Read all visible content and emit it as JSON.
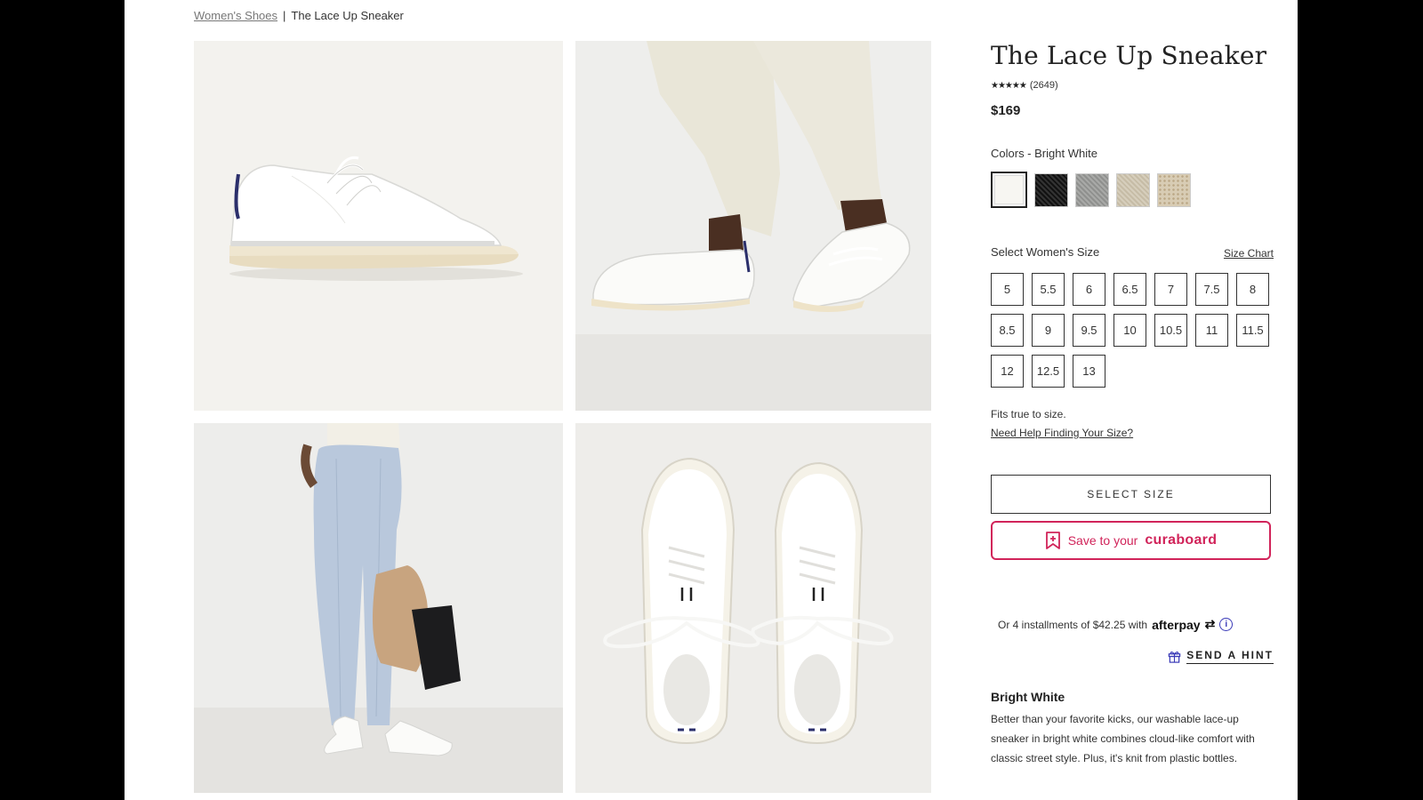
{
  "breadcrumb": {
    "parent": "Women's Shoes",
    "separator": "|",
    "current": "The Lace Up Sneaker"
  },
  "product": {
    "title": "The Lace Up Sneaker",
    "stars": "★★★★★",
    "rating": 4.5,
    "review_count": "(2649)",
    "price": "$169"
  },
  "colors": {
    "label": "Colors - Bright White",
    "swatches": [
      {
        "name": "Bright White",
        "color": "#f7f6f2",
        "selected": true
      },
      {
        "name": "Black",
        "color": "#1c1c1e",
        "selected": false
      },
      {
        "name": "Grey",
        "color": "#9b9c9a",
        "selected": false
      },
      {
        "name": "Sand",
        "color": "#cfc6b2",
        "selected": false
      },
      {
        "name": "Speckle",
        "color": "#d8ccb4",
        "selected": false
      }
    ]
  },
  "size": {
    "label": "Select Women's Size",
    "chart_link": "Size Chart",
    "options": [
      "5",
      "5.5",
      "6",
      "6.5",
      "7",
      "7.5",
      "8",
      "8.5",
      "9",
      "9.5",
      "10",
      "10.5",
      "11",
      "11.5",
      "12",
      "12.5",
      "13"
    ],
    "fits": "Fits true to size.",
    "help_link": "Need Help Finding Your Size?"
  },
  "actions": {
    "select_size": "SELECT SIZE",
    "save_prefix": "Save to your",
    "save_brand": "curaboard"
  },
  "afterpay": {
    "text": "Or 4 installments of $42.25 with",
    "brand": "afterpay",
    "brand_symbol": "⇄",
    "info": "i"
  },
  "hint": {
    "label": "SEND A HINT"
  },
  "description": {
    "title": "Bright White",
    "body": "Better than your favorite kicks, our washable lace-up sneaker in bright white combines cloud-like comfort with classic street style. Plus, it's knit from plastic bottles."
  },
  "accent": "#d1245a"
}
